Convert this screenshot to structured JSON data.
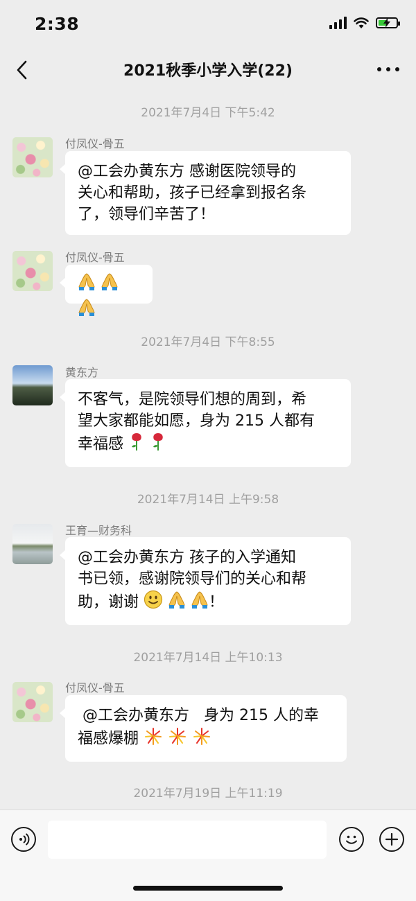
{
  "status_bar": {
    "time": "2:38"
  },
  "header": {
    "title": "2021秋季小学入学(22)"
  },
  "timestamps": {
    "t1": "2021年7月4日 下午5:42",
    "t2": "2021年7月4日 下午8:55",
    "t3": "2021年7月14日 上午9:58",
    "t4": "2021年7月14日 上午10:13",
    "t5": "2021年7月19日 上午11:19"
  },
  "messages": [
    {
      "sender": "付凤仪-骨五",
      "line1": "@工会办黄东方 感谢医院领导的",
      "line2": "关心和帮助，孩子已经拿到报名条",
      "line3": "了，领导们辛苦了！"
    },
    {
      "sender": "付凤仪-骨五"
    },
    {
      "sender": "黄东方",
      "line1": "不客气，是院领导们想的周到，希",
      "line2": "望大家都能如愿，身为 215 人都有",
      "line3": "幸福感"
    },
    {
      "sender": "王育—财务科",
      "line1": "@工会办黄东方 孩子的入学通知",
      "line2": "书已领，感谢院领导们的关心和帮",
      "line3": "助，谢谢",
      "line3_end": "！"
    },
    {
      "sender": "付凤仪-骨五",
      "line1": " @工会办黄东方   身为 215 人的幸",
      "line2": "福感爆棚"
    }
  ],
  "icons": {
    "back": "chevron-left-icon",
    "more": "more-dots-icon",
    "voice": "voice-icon",
    "emoji": "emoji-icon",
    "add": "plus-icon",
    "pray": "folded-hands-emoji",
    "rose": "rose-emoji",
    "smile": "smile-emoji",
    "firework": "firework-emoji"
  },
  "input": {
    "value": ""
  },
  "colors": {
    "background": "#ededed",
    "bubble": "#ffffff",
    "timestamp": "#a0a0a0",
    "sender": "#7c7c7c",
    "battery": "#37c837"
  }
}
